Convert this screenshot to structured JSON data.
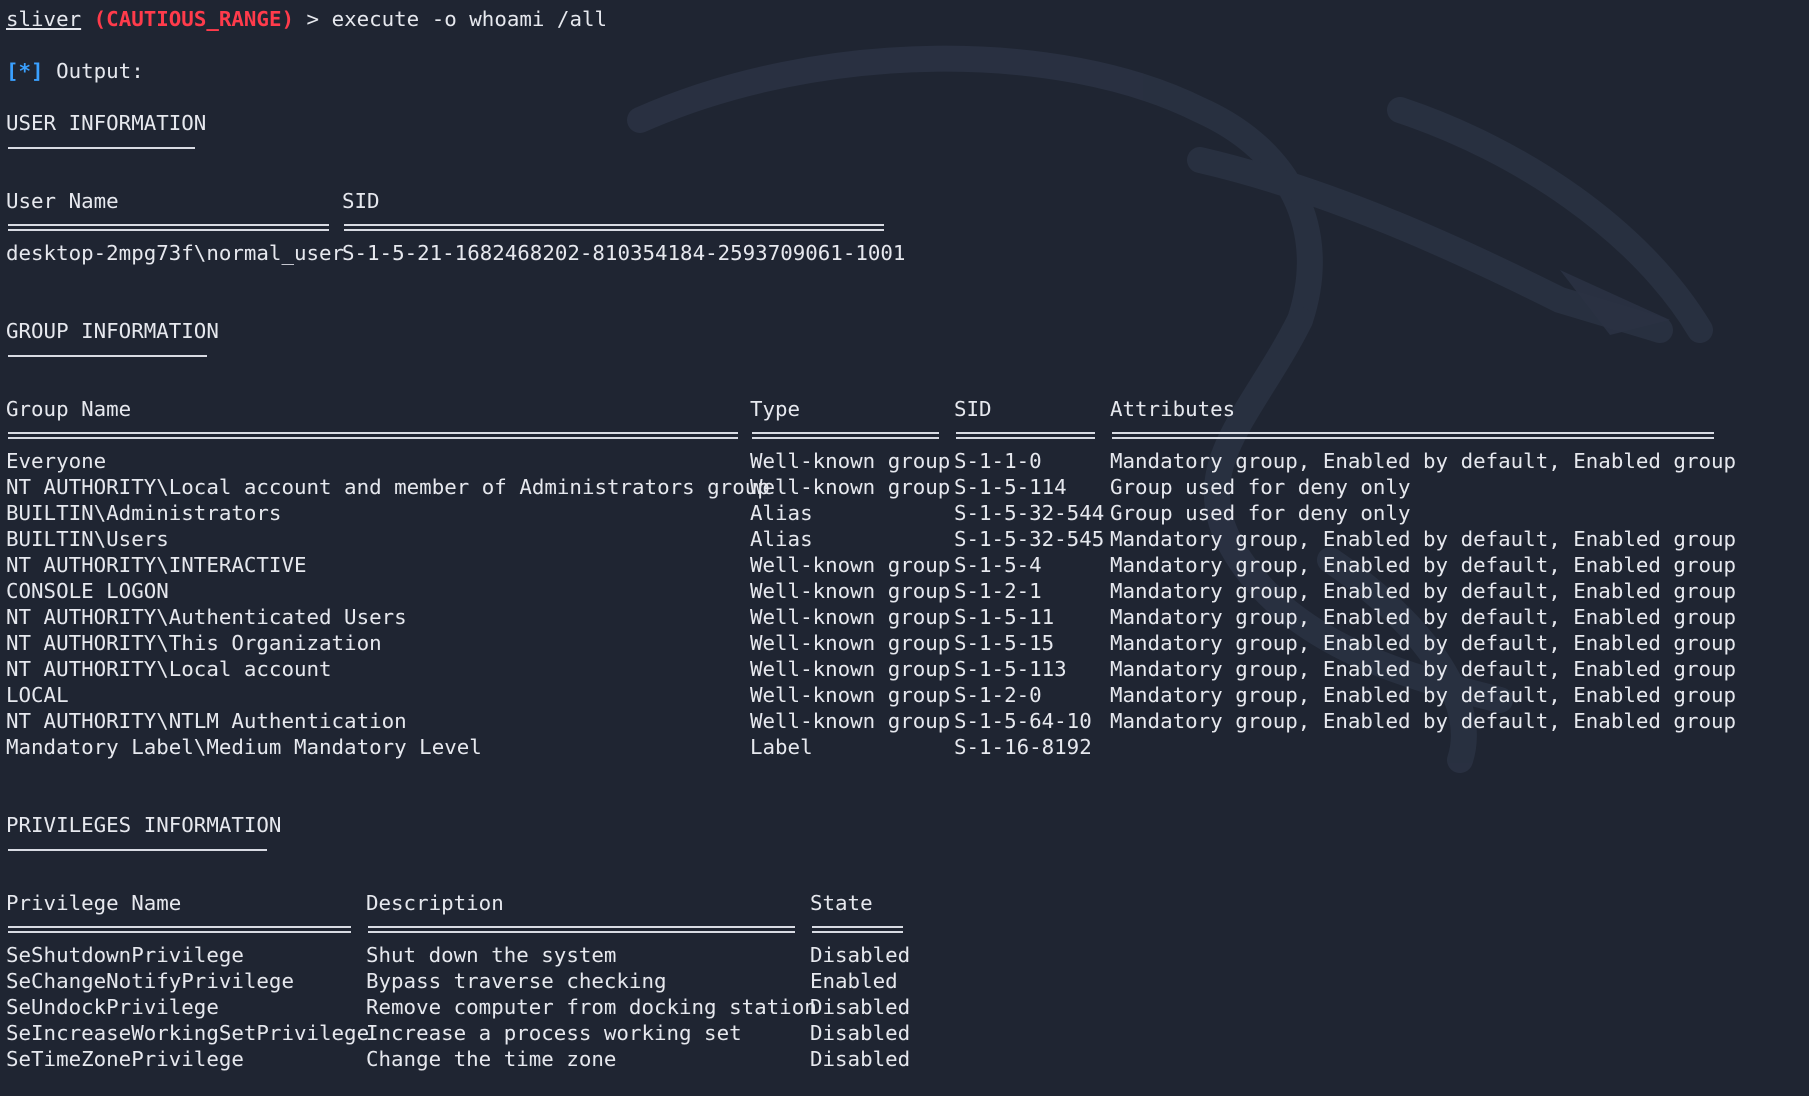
{
  "prompt": {
    "app": "sliver",
    "session": "(CAUTIOUS_RANGE)",
    "arrow": " > ",
    "command": "execute -o whoami /all"
  },
  "output_label": {
    "marker": "[*]",
    "text": " Output:"
  },
  "user_info": {
    "title": "USER INFORMATION",
    "headers": [
      "User Name",
      "SID"
    ],
    "rows": [
      [
        "desktop-2mpg73f\\normal_user",
        "S-1-5-21-1682468202-810354184-2593709061-1001"
      ]
    ]
  },
  "group_info": {
    "title": "GROUP INFORMATION",
    "headers": [
      "Group Name",
      "Type",
      "SID",
      "Attributes"
    ],
    "rows": [
      [
        "Everyone",
        "Well-known group",
        "S-1-1-0",
        "Mandatory group, Enabled by default, Enabled group"
      ],
      [
        "NT AUTHORITY\\Local account and member of Administrators group",
        "Well-known group",
        "S-1-5-114",
        "Group used for deny only"
      ],
      [
        "BUILTIN\\Administrators",
        "Alias",
        "S-1-5-32-544",
        "Group used for deny only"
      ],
      [
        "BUILTIN\\Users",
        "Alias",
        "S-1-5-32-545",
        "Mandatory group, Enabled by default, Enabled group"
      ],
      [
        "NT AUTHORITY\\INTERACTIVE",
        "Well-known group",
        "S-1-5-4",
        "Mandatory group, Enabled by default, Enabled group"
      ],
      [
        "CONSOLE LOGON",
        "Well-known group",
        "S-1-2-1",
        "Mandatory group, Enabled by default, Enabled group"
      ],
      [
        "NT AUTHORITY\\Authenticated Users",
        "Well-known group",
        "S-1-5-11",
        "Mandatory group, Enabled by default, Enabled group"
      ],
      [
        "NT AUTHORITY\\This Organization",
        "Well-known group",
        "S-1-5-15",
        "Mandatory group, Enabled by default, Enabled group"
      ],
      [
        "NT AUTHORITY\\Local account",
        "Well-known group",
        "S-1-5-113",
        "Mandatory group, Enabled by default, Enabled group"
      ],
      [
        "LOCAL",
        "Well-known group",
        "S-1-2-0",
        "Mandatory group, Enabled by default, Enabled group"
      ],
      [
        "NT AUTHORITY\\NTLM Authentication",
        "Well-known group",
        "S-1-5-64-10",
        "Mandatory group, Enabled by default, Enabled group"
      ],
      [
        "Mandatory Label\\Medium Mandatory Level",
        "Label",
        "S-1-16-8192",
        ""
      ]
    ]
  },
  "privileges_info": {
    "title": "PRIVILEGES INFORMATION",
    "headers": [
      "Privilege Name",
      "Description",
      "State"
    ],
    "rows": [
      [
        "SeShutdownPrivilege",
        "Shut down the system",
        "Disabled"
      ],
      [
        "SeChangeNotifyPrivilege",
        "Bypass traverse checking",
        "Enabled"
      ],
      [
        "SeUndockPrivilege",
        "Remove computer from docking station",
        "Disabled"
      ],
      [
        "SeIncreaseWorkingSetPrivilege",
        "Increase a process working set",
        "Disabled"
      ],
      [
        "SeTimeZonePrivilege",
        "Change the time zone",
        "Disabled"
      ]
    ]
  },
  "colors": {
    "background": "#1f2532",
    "foreground": "#e6e8ee",
    "session": "#ff3b4b",
    "marker": "#3aa0ff"
  },
  "background_icon": "kali-dragon-watermark"
}
